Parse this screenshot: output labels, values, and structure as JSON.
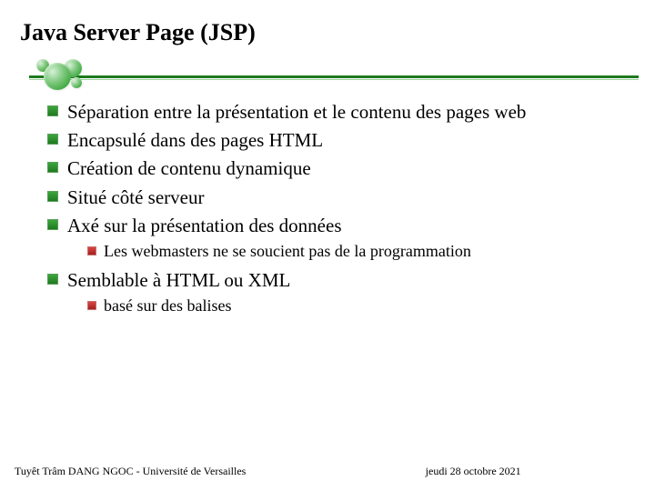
{
  "title": "Java Server Page (JSP)",
  "bullets": {
    "b1": "Séparation entre la présentation et le contenu des pages web",
    "b2": "Encapsulé dans des pages HTML",
    "b3": "Création de contenu dynamique",
    "b4": "Situé côté serveur",
    "b5": "Axé sur la présentation des données",
    "b5_1": "Les webmasters ne se soucient pas de la programmation",
    "b6": "Semblable à HTML ou XML",
    "b6_1": "basé sur des balises"
  },
  "footer": {
    "left": "Tuyêt Trâm DANG NGOC - Université de Versailles",
    "center": "jeudi 28 octobre 2021"
  }
}
